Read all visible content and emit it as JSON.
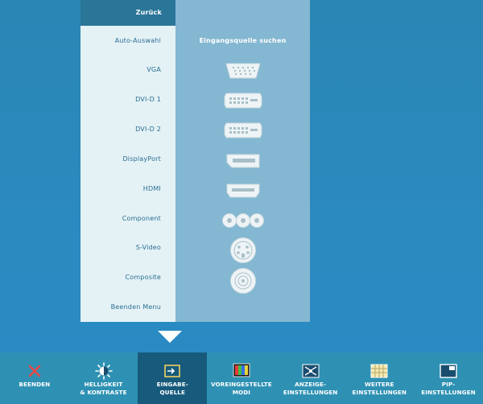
{
  "input_menu": {
    "items": [
      {
        "label": "Zurück",
        "icon": null
      },
      {
        "label": "Auto-Auswahl",
        "icon": "search-text"
      },
      {
        "label": "VGA",
        "icon": "vga-connector-icon"
      },
      {
        "label": "DVI-D 1",
        "icon": "dvi-connector-icon"
      },
      {
        "label": "DVI-D 2",
        "icon": "dvi-connector-icon"
      },
      {
        "label": "DisplayPort",
        "icon": "displayport-connector-icon"
      },
      {
        "label": "HDMI",
        "icon": "hdmi-connector-icon"
      },
      {
        "label": "Component",
        "icon": "component-rca-icon"
      },
      {
        "label": "S-Video",
        "icon": "svideo-connector-icon"
      },
      {
        "label": "Composite",
        "icon": "composite-rca-icon"
      },
      {
        "label": "Beenden Menu",
        "icon": null
      }
    ],
    "auto_select_text": "Eingangsquelle suchen"
  },
  "bottom_bar": {
    "items": [
      {
        "label": "BEENDEN",
        "icon": "close-x-icon"
      },
      {
        "label": "HELLIGKEIT\n& KONTRASTE",
        "icon": "brightness-icon"
      },
      {
        "label": "EINGABE-\nQUELLE",
        "icon": "input-source-icon",
        "active": true
      },
      {
        "label": "VOREINGESTELLTE\nMODI",
        "icon": "color-modes-icon"
      },
      {
        "label": "ANZEIGE-\nEINSTELLUNGEN",
        "icon": "display-settings-icon"
      },
      {
        "label": "WEITERE\nEINSTELLUNGEN",
        "icon": "other-settings-icon"
      },
      {
        "label": "PIP-\nEINSTELLUNGEN",
        "icon": "pip-icon"
      }
    ]
  },
  "colors": {
    "background": "#2a89c3",
    "menu_left_bg": "#e4f2f6",
    "menu_right_bg": "#84b7d1",
    "back_button_bg": "#2a7598",
    "bar_bg": "#2e91b3",
    "bar_active_bg": "#175a7b",
    "close_red": "#e64a4a"
  }
}
